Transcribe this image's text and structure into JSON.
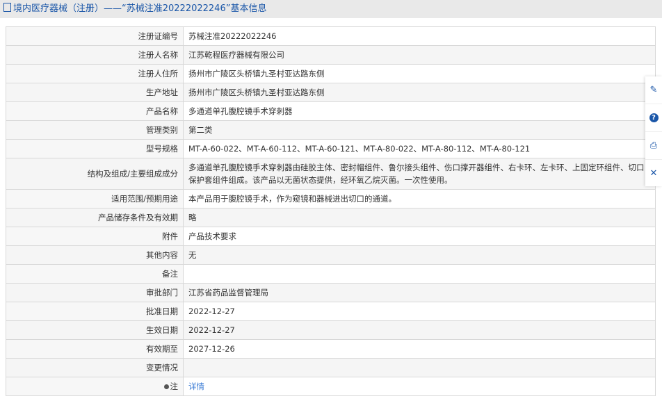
{
  "header": {
    "title": "境内医疗器械（注册）——“苏械注准20222022246”基本信息"
  },
  "rows": [
    {
      "label": "注册证编号",
      "value": "苏械注准20222022246"
    },
    {
      "label": "注册人名称",
      "value": "江苏乾程医疗器械有限公司"
    },
    {
      "label": "注册人住所",
      "value": "扬州市广陵区头桥镇九圣村亚达路东侧"
    },
    {
      "label": "生产地址",
      "value": "扬州市广陵区头桥镇九圣村亚达路东侧"
    },
    {
      "label": "产品名称",
      "value": "多通道单孔腹腔镜手术穿刺器"
    },
    {
      "label": "管理类别",
      "value": "第二类"
    },
    {
      "label": "型号规格",
      "value": "MT-A-60-022、MT-A-60-112、MT-A-60-121、MT-A-80-022、MT-A-80-112、MT-A-80-121"
    },
    {
      "label": "结构及组成/主要组成成分",
      "value": "多通道单孔腹腔镜手术穿刺器由硅胶主体、密封帽组件、鲁尔接头组件、伤口撑开器组件、右卡环、左卡环、上固定环组件、切口保护套组件组成。该产品以无菌状态提供，经环氧乙烷灭菌。一次性使用。"
    },
    {
      "label": "适用范围/预期用途",
      "value": "本产品用于腹腔镜手术，作为窥镜和器械进出切口的通道。"
    },
    {
      "label": "产品储存条件及有效期",
      "value": "略"
    },
    {
      "label": "附件",
      "value": "产品技术要求"
    },
    {
      "label": "其他内容",
      "value": "无"
    },
    {
      "label": "备注",
      "value": ""
    },
    {
      "label": "审批部门",
      "value": "江苏省药品监督管理局"
    },
    {
      "label": "批准日期",
      "value": "2022-12-27"
    },
    {
      "label": "生效日期",
      "value": "2022-12-27"
    },
    {
      "label": "有效期至",
      "value": "2027-12-26"
    },
    {
      "label": "变更情况",
      "value": ""
    }
  ],
  "note": {
    "label": "注",
    "link": "详情"
  },
  "side": {
    "q": "?"
  }
}
